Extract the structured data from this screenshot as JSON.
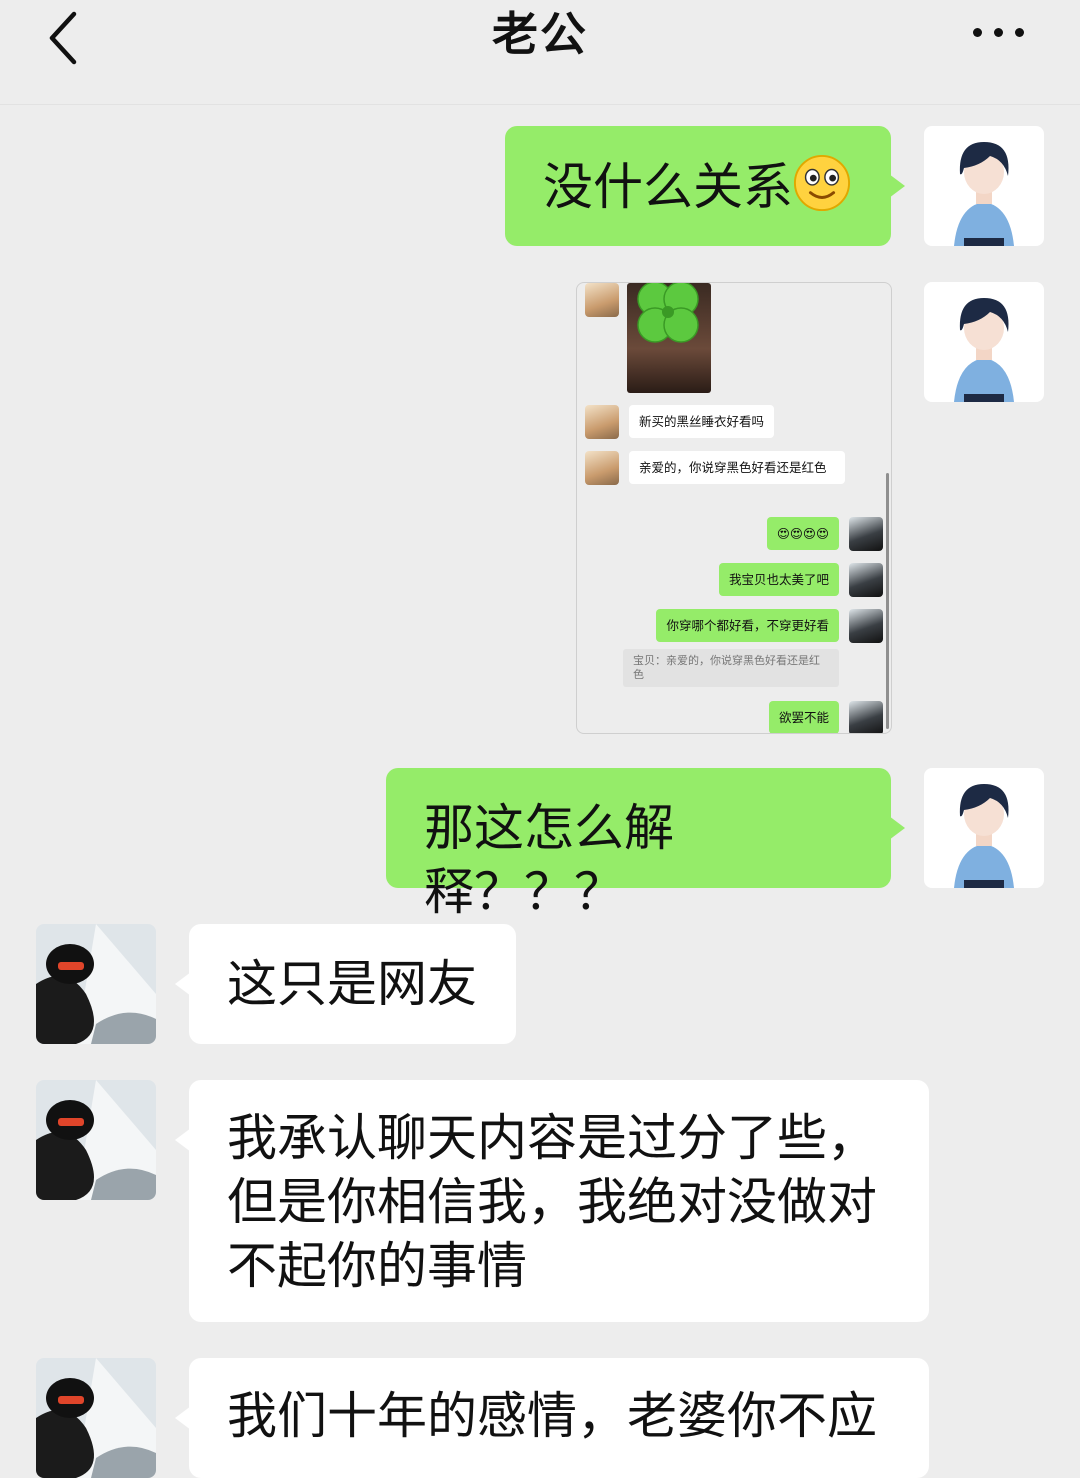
{
  "header": {
    "title": "老公",
    "back_icon": "chevron-left-icon",
    "more_icon": "more-dots-icon"
  },
  "messages": [
    {
      "sender": "me",
      "type": "text",
      "text": "没什么关系",
      "emoji": "smiley-face-emoji"
    },
    {
      "sender": "me",
      "type": "image",
      "description_icon": "chat-screenshot-image"
    },
    {
      "sender": "me",
      "type": "text",
      "text": "那这怎么解释？？？"
    },
    {
      "sender": "other",
      "type": "text",
      "text": "这只是网友"
    },
    {
      "sender": "other",
      "type": "text",
      "lines": [
        "我承认聊天内容是过分了些，",
        "但是你相信我，我绝对没做对",
        "不起你的事情"
      ]
    },
    {
      "sender": "other",
      "type": "text",
      "text": "我们十年的感情，老婆你不应"
    }
  ],
  "screenshot": {
    "messages": [
      {
        "side": "left",
        "text": "新买的黑丝睡衣好看吗"
      },
      {
        "side": "left",
        "text": "亲爱的，你说穿黑色好看还是红色"
      },
      {
        "side": "right",
        "text": "😍😍😍😍"
      },
      {
        "side": "right",
        "text": "我宝贝也太美了吧"
      },
      {
        "side": "right",
        "text": "你穿哪个都好看，不穿更好看"
      },
      {
        "side": "quote",
        "text": "宝贝：亲爱的，你说穿黑色好看还是红色"
      },
      {
        "side": "right",
        "text": "欲罢不能"
      }
    ],
    "sticker": "four-leaf-clover-sticker"
  },
  "colors": {
    "background": "#ededed",
    "my_bubble": "#95ec69",
    "other_bubble": "#ffffff"
  }
}
